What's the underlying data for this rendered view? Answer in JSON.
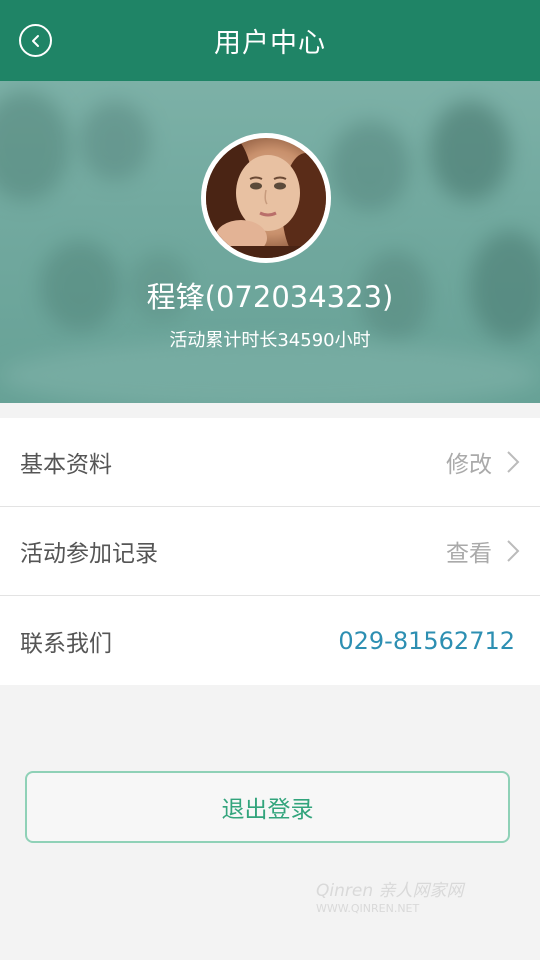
{
  "header": {
    "title": "用户中心",
    "back_icon": "back-arrow-circle-icon",
    "background": "#1f8466"
  },
  "profile": {
    "username": "程锋(072034323)",
    "activity_duration": "活动累计时长34590小时"
  },
  "menu": {
    "items": [
      {
        "label": "基本资料",
        "action": "修改",
        "icon": "chevron-right-icon"
      },
      {
        "label": "活动参加记录",
        "action": "查看",
        "icon": "chevron-right-icon"
      },
      {
        "label": "联系我们",
        "phone": "029-81562712"
      }
    ]
  },
  "logout": {
    "label": "退出登录"
  },
  "watermark": {
    "brand": "Qinren 亲人网家网",
    "line2": "WWW.QINREN.NET"
  },
  "colors": {
    "accent": "#1f8466",
    "phone": "#2d8fb2",
    "logout_text": "#32a47c",
    "logout_border": "#8fd1b7"
  }
}
